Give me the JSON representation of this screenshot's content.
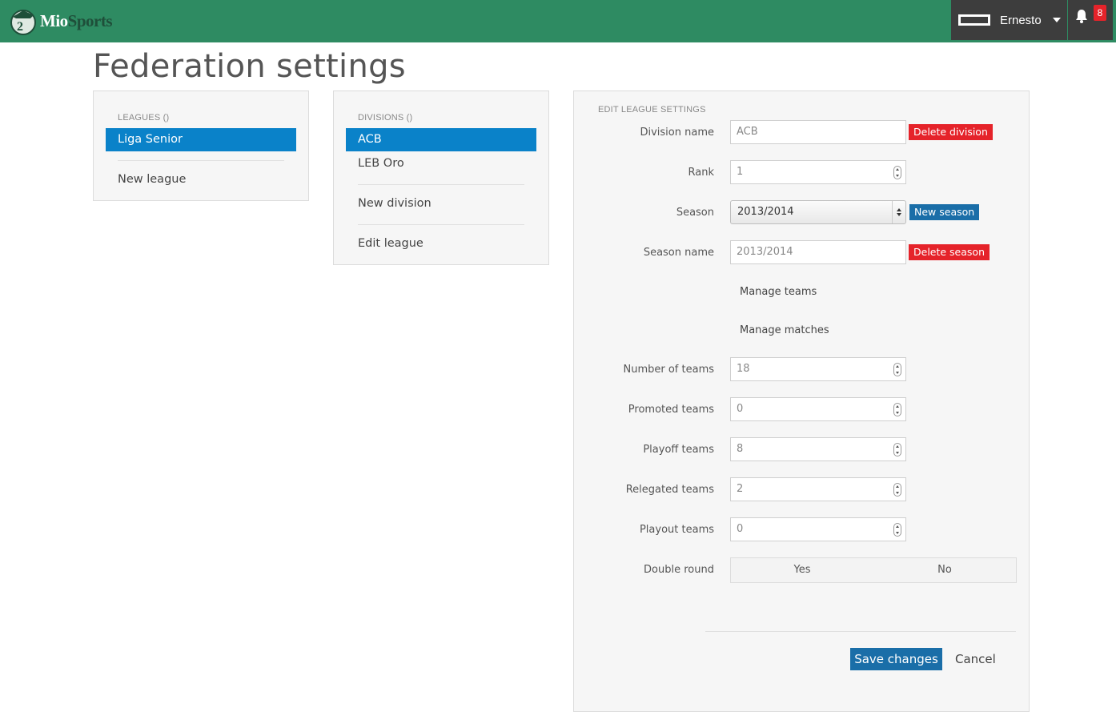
{
  "app": {
    "logo_text": "MioSports",
    "logo_parts": [
      "Mio",
      "Sports"
    ],
    "user_name": "Ernesto",
    "notification_count": "8"
  },
  "page": {
    "title": "Federation settings"
  },
  "leagues_panel": {
    "label": "LEAGUES ()",
    "items": [
      {
        "label": "Liga Senior",
        "active": true
      }
    ],
    "new_label": "New league"
  },
  "divisions_panel": {
    "label": "DIVISIONS ()",
    "items": [
      {
        "label": "ACB",
        "active": true
      },
      {
        "label": "LEB Oro",
        "active": false
      }
    ],
    "new_label": "New division",
    "edit_label": "Edit league"
  },
  "edit_panel": {
    "label": "EDIT LEAGUE SETTINGS",
    "division_name": {
      "label": "Division name",
      "value": "ACB",
      "action": "Delete division"
    },
    "rank": {
      "label": "Rank",
      "value": "1"
    },
    "season": {
      "label": "Season",
      "value": "2013/2014",
      "action": "New season"
    },
    "season_name": {
      "label": "Season name",
      "value": "2013/2014",
      "action": "Delete season"
    },
    "manage_teams": "Manage teams",
    "manage_matches": "Manage matches",
    "number_of_teams": {
      "label": "Number of teams",
      "value": "18"
    },
    "promoted_teams": {
      "label": "Promoted teams",
      "value": "0"
    },
    "playoff_teams": {
      "label": "Playoff teams",
      "value": "8"
    },
    "relegated_teams": {
      "label": "Relegated teams",
      "value": "2"
    },
    "playout_teams": {
      "label": "Playout teams",
      "value": "0"
    },
    "double_round": {
      "label": "Double round",
      "yes": "Yes",
      "no": "No"
    },
    "save_label": "Save changes",
    "cancel_label": "Cancel"
  },
  "colors": {
    "topbar": "#2e8b62",
    "active_item": "#0a82c9",
    "danger": "#e5232a",
    "primary": "#1a6ea8"
  }
}
